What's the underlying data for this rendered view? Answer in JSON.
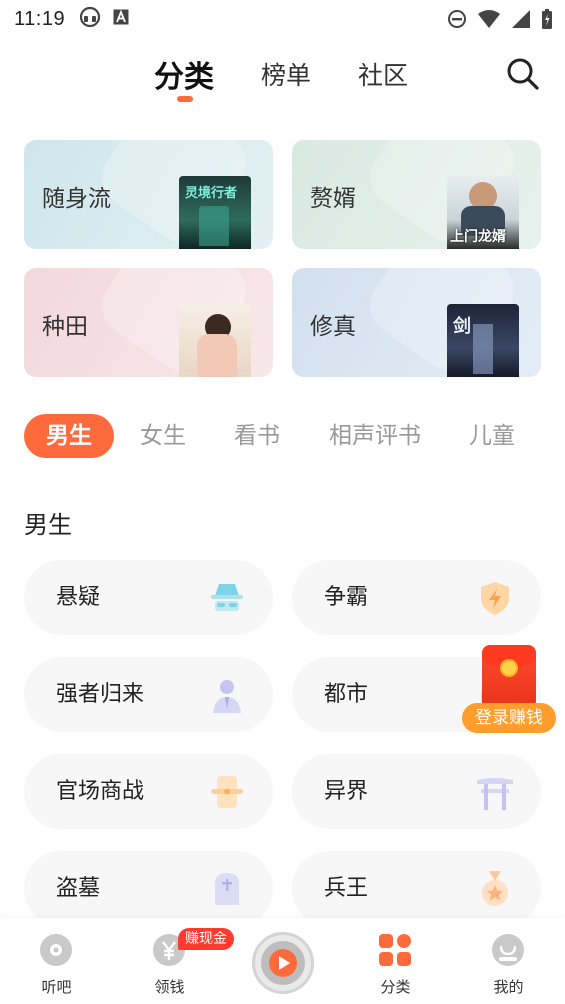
{
  "status_bar": {
    "time": "11:19"
  },
  "top_tabs": [
    {
      "label": "分类",
      "active": true
    },
    {
      "label": "榜单",
      "active": false
    },
    {
      "label": "社区",
      "active": false
    }
  ],
  "feature_cards": [
    {
      "title": "随身流",
      "cover_text": "灵境行者",
      "bg": "#d3e9ee"
    },
    {
      "title": "赘婿",
      "cover_text": "上门龙婿",
      "bg": "#dfece6"
    },
    {
      "title": "种田",
      "cover_text": "",
      "bg": "#f6dfe3"
    },
    {
      "title": "修真",
      "cover_text": "剑",
      "bg": "#d8e4f1"
    }
  ],
  "chips": [
    "男生",
    "女生",
    "看书",
    "相声评书",
    "儿童"
  ],
  "section_title": "男生",
  "genres": [
    {
      "label": "悬疑",
      "icon": "detective-icon"
    },
    {
      "label": "争霸",
      "icon": "shield-bolt-icon"
    },
    {
      "label": "强者归来",
      "icon": "businessman-icon"
    },
    {
      "label": "都市",
      "icon": "city-icon"
    },
    {
      "label": "官场商战",
      "icon": "scroll-icon"
    },
    {
      "label": "异界",
      "icon": "torii-gate-icon"
    },
    {
      "label": "盗墓",
      "icon": "tombstone-icon"
    },
    {
      "label": "兵王",
      "icon": "medal-icon"
    }
  ],
  "red_packet": {
    "label": "登录赚钱"
  },
  "bottom_nav": [
    {
      "label": "听吧",
      "icon": "music-disc-icon",
      "active": false
    },
    {
      "label": "领钱",
      "icon": "yuan-coin-icon",
      "active": false,
      "badge": "赚现金"
    },
    {
      "label": "",
      "icon": "play-icon",
      "active": false
    },
    {
      "label": "分类",
      "icon": "category-grid-icon",
      "active": true
    },
    {
      "label": "我的",
      "icon": "profile-icon",
      "active": false
    }
  ],
  "colors": {
    "accent": "#ff6a3d",
    "badge": "#ff3b30"
  }
}
